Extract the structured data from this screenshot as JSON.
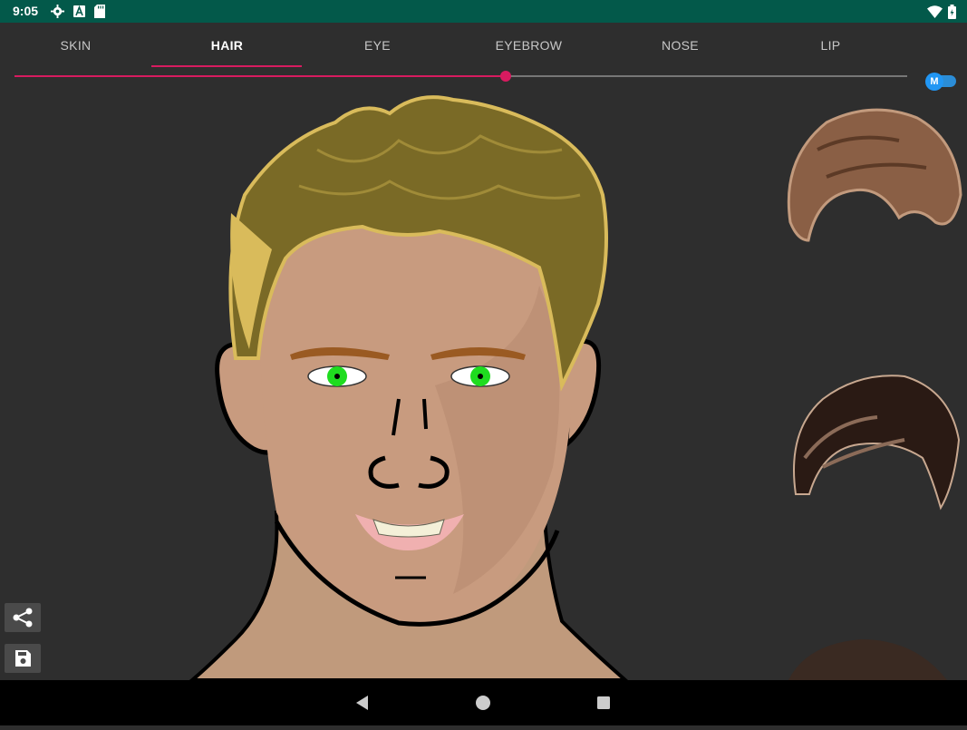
{
  "status_bar": {
    "time": "9:05",
    "left_icons": [
      "gear-icon",
      "text-a-icon",
      "sd-card-icon"
    ],
    "right_icons": [
      "wifi-icon",
      "battery-icon"
    ]
  },
  "tabs": [
    {
      "label": "SKIN",
      "active": false
    },
    {
      "label": "HAIR",
      "active": true
    },
    {
      "label": "EYE",
      "active": false
    },
    {
      "label": "EYEBROW",
      "active": false
    },
    {
      "label": "NOSE",
      "active": false
    },
    {
      "label": "LIP",
      "active": false
    }
  ],
  "slider": {
    "value": 0.55,
    "accent": "#d81b60"
  },
  "mirror_toggle": {
    "label": "M",
    "on": true,
    "color": "#2196f3"
  },
  "colors": {
    "status_bar": "#03594a",
    "background": "#2e2e2e",
    "skin": "#c89b7f",
    "hair": "#7a6a26",
    "eye_iris": "#1fdc1f",
    "eyebrow": "#9a5a22",
    "lip": "#f0b0b0"
  },
  "hair_options": [
    "hair-style-brown-curl",
    "hair-style-dark-spiky",
    "hair-style-dark-partial"
  ],
  "side_buttons": [
    "share-icon",
    "save-icon"
  ],
  "nav_buttons": [
    "back-icon",
    "home-icon",
    "recents-icon"
  ]
}
